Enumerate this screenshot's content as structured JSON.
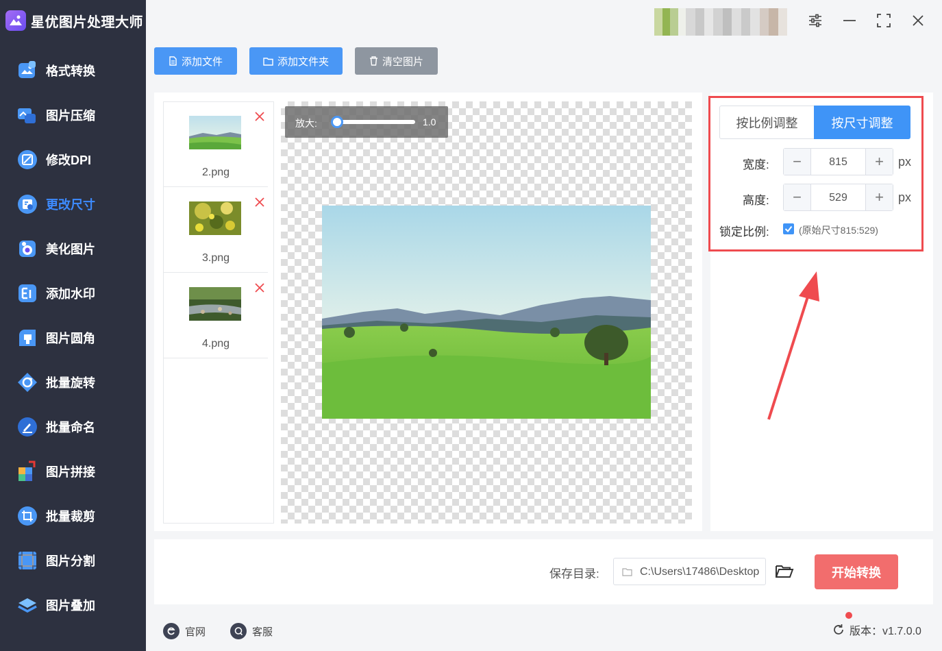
{
  "app": {
    "title": "星优图片处理大师"
  },
  "sidebar": {
    "items": [
      {
        "label": "格式转换",
        "icon": "format-convert-icon"
      },
      {
        "label": "图片压缩",
        "icon": "compress-icon"
      },
      {
        "label": "修改DPI",
        "icon": "dpi-icon"
      },
      {
        "label": "更改尺寸",
        "icon": "resize-icon",
        "active": true
      },
      {
        "label": "美化图片",
        "icon": "beautify-icon"
      },
      {
        "label": "添加水印",
        "icon": "watermark-icon"
      },
      {
        "label": "图片圆角",
        "icon": "round-corner-icon"
      },
      {
        "label": "批量旋转",
        "icon": "rotate-icon"
      },
      {
        "label": "批量命名",
        "icon": "rename-icon"
      },
      {
        "label": "图片拼接",
        "icon": "stitch-icon"
      },
      {
        "label": "批量裁剪",
        "icon": "crop-icon"
      },
      {
        "label": "图片分割",
        "icon": "split-icon"
      },
      {
        "label": "图片叠加",
        "icon": "overlay-icon"
      }
    ]
  },
  "toolbar": {
    "add_file": "添加文件",
    "add_folder": "添加文件夹",
    "clear": "清空图片"
  },
  "files": [
    {
      "name": "2.png"
    },
    {
      "name": "3.png"
    },
    {
      "name": "4.png"
    }
  ],
  "preview": {
    "zoom_label": "放大:",
    "zoom_value": "1.0",
    "zoom_fraction": 0.0
  },
  "resize": {
    "tab_ratio": "按比例调整",
    "tab_size": "按尺寸调整",
    "width_label": "宽度:",
    "width_value": "815",
    "height_label": "高度:",
    "height_value": "529",
    "unit": "px",
    "lock_label": "锁定比例:",
    "lock_checked": true,
    "original_size": "(原始尺寸815:529)"
  },
  "output": {
    "save_label": "保存目录:",
    "save_path": "C:\\Users\\17486\\Desktop",
    "start_button": "开始转换"
  },
  "footer": {
    "website": "官网",
    "support": "客服",
    "version": "版本：v1.7.0.0"
  },
  "colors": {
    "sidebar_bg": "#2d3140",
    "accent": "#3f94f7",
    "start": "#f26d6d",
    "highlight": "#ef4b4f"
  }
}
